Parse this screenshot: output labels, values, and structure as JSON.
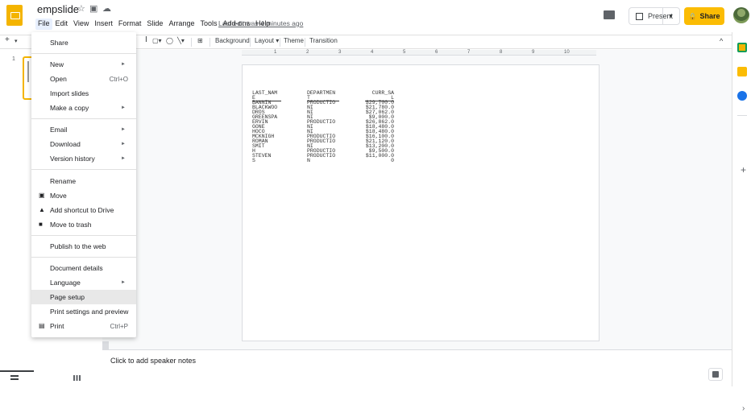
{
  "app": {
    "doc_title": "empslide",
    "star_icon": "star-icon",
    "move_icon": "folder-move-icon",
    "cloud_icon": "cloud-status-icon",
    "last_edit": "Last edit was 4 minutes ago",
    "accent": "#f4b400"
  },
  "menubar": [
    "File",
    "Edit",
    "View",
    "Insert",
    "Format",
    "Slide",
    "Arrange",
    "Tools",
    "Add-ons",
    "Help"
  ],
  "header_actions": {
    "present": "Present",
    "share": "Share",
    "share_color": "#fbbc04"
  },
  "toolbar": {
    "new_slide": "+",
    "background": "Background",
    "layout": "Layout",
    "theme": "Theme",
    "transition": "Transition"
  },
  "ruler": [
    "1",
    "2",
    "3",
    "4",
    "5",
    "6",
    "7",
    "8",
    "9",
    "10"
  ],
  "filmstrip": {
    "slide_number": "1"
  },
  "slide": {
    "headers": [
      "LAST_NAM",
      "DEPARTMEN",
      "CURR_SA"
    ],
    "headers_2": [
      "E",
      "T",
      "L"
    ],
    "rows": [
      [
        "BANNIN",
        "PRODUCTIO",
        "$29,700.0"
      ],
      [
        "BLACKWOO",
        "NI",
        "$21,780.0"
      ],
      [
        "DROS",
        "NI",
        "$27,062.0"
      ],
      [
        "GREENSPA",
        "NI",
        "$9,000.0"
      ],
      [
        "ERVIN",
        "PRODUCTIO",
        "$26,862.0"
      ],
      [
        "GONE",
        "NI",
        "$18,480.0"
      ],
      [
        "HOCO",
        "NI",
        "$18,480.0"
      ],
      [
        "MCKNIGH",
        "PRODUCTIO",
        "$16,100.0"
      ],
      [
        "ROMAN",
        "PRODUCTIO",
        "$21,120.0"
      ],
      [
        "SMIT",
        "NI",
        "$13,200.0"
      ],
      [
        "H",
        "PRODUCTIO",
        "$9,500.0"
      ],
      [
        "STEVEN",
        "PRODUCTIO",
        "$11,000.0"
      ],
      [
        "S",
        "N",
        "0"
      ]
    ]
  },
  "notes_placeholder": "Click to add speaker notes",
  "file_menu": {
    "share": "Share",
    "new": "New",
    "open": "Open",
    "open_shortcut": "Ctrl+O",
    "import_slides": "Import slides",
    "make_copy": "Make a copy",
    "email": "Email",
    "download": "Download",
    "version_history": "Version history",
    "rename": "Rename",
    "move": "Move",
    "add_shortcut": "Add shortcut to Drive",
    "move_to_trash": "Move to trash",
    "publish": "Publish to the web",
    "document_details": "Document details",
    "language": "Language",
    "page_setup": "Page setup",
    "print_settings": "Print settings and preview",
    "print": "Print",
    "print_shortcut": "Ctrl+P"
  }
}
